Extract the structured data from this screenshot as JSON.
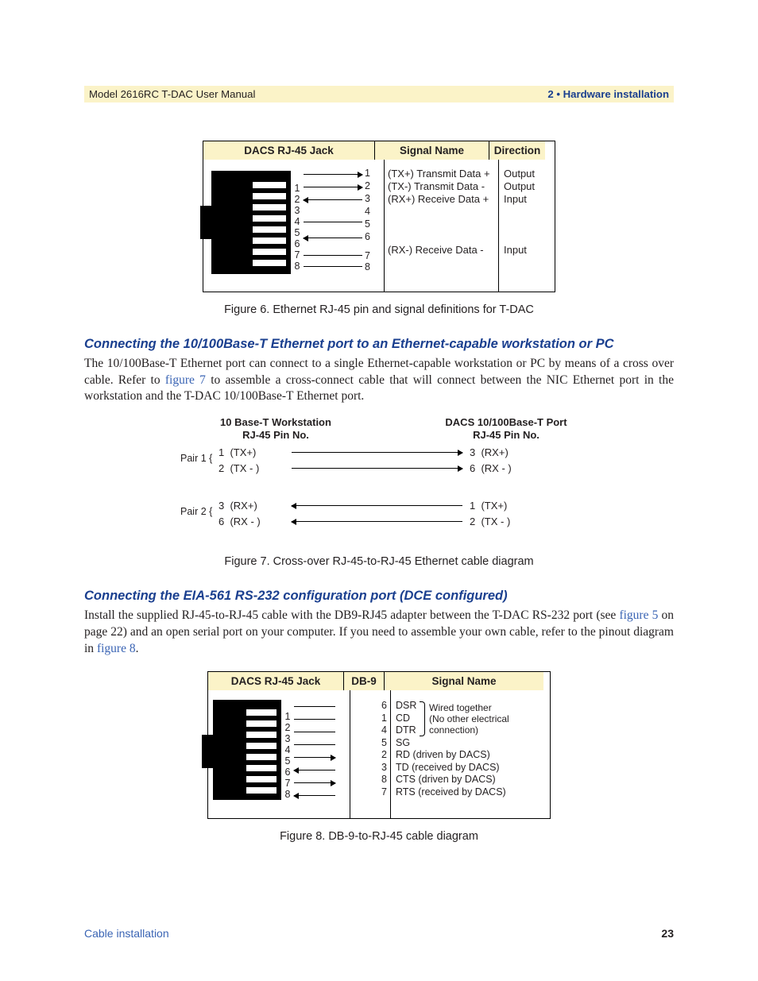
{
  "header": {
    "left": "Model 2616RC T-DAC User Manual",
    "right": "2 • Hardware installation"
  },
  "figure6": {
    "caption": "Figure 6. Ethernet RJ-45 pin and signal definitions for T-DAC",
    "cols": [
      "DACS RJ-45 Jack",
      "Signal Name",
      "Direction"
    ],
    "pins_drawn": [
      1,
      2,
      3,
      4,
      5,
      6,
      7,
      8
    ],
    "leads": [
      {
        "jack_pin": 1,
        "far_pin": 1,
        "dir": "out",
        "signal": "(TX+) Transmit Data +",
        "direction": "Output"
      },
      {
        "jack_pin": 2,
        "far_pin": 2,
        "dir": "out",
        "signal": "(TX-) Transmit Data -",
        "direction": "Output"
      },
      {
        "jack_pin": 3,
        "far_pin": 3,
        "dir": "in",
        "signal": "(RX+) Receive Data +",
        "direction": "Input"
      },
      {
        "jack_pin": 6,
        "far_pin": 6,
        "dir": "in",
        "signal": "(RX-) Receive Data -",
        "direction": "Input"
      }
    ]
  },
  "section1": {
    "title": "Connecting the 10/100Base-T Ethernet port to an Ethernet-capable workstation or PC",
    "para_a": "The 10/100Base-T Ethernet port can connect to a single Ethernet-capable workstation or PC by means of a cross over cable. Refer to ",
    "link7": "figure 7",
    "para_b": " to assemble a cross-connect cable that will connect between the NIC Ethernet port in the workstation and the T-DAC 10/100Base-T Ethernet port."
  },
  "figure7": {
    "caption": "Figure 7. Cross-over RJ-45-to-RJ-45 Ethernet cable diagram",
    "left_head_a": "10 Base-T Workstation",
    "left_head_b": "RJ-45 Pin No.",
    "right_head_a": "DACS 10/100Base-T Port",
    "right_head_b": "RJ-45 Pin No.",
    "pair1_label": "Pair 1 {",
    "pair2_label": "Pair 2 {",
    "rows": [
      {
        "l_pin": "1",
        "l_sig": "(TX+)",
        "r_pin": "3",
        "r_sig": "(RX+)",
        "arrow": "r"
      },
      {
        "l_pin": "2",
        "l_sig": "(TX - )",
        "r_pin": "6",
        "r_sig": "(RX - )",
        "arrow": "r"
      },
      {
        "l_pin": "3",
        "l_sig": "(RX+)",
        "r_pin": "1",
        "r_sig": "(TX+)",
        "arrow": "l"
      },
      {
        "l_pin": "6",
        "l_sig": "(RX - )",
        "r_pin": "2",
        "r_sig": "(TX - )",
        "arrow": "l"
      }
    ]
  },
  "section2": {
    "title": "Connecting the EIA-561 RS-232 configuration port (DCE configured)",
    "para_a": "Install the supplied RJ-45-to-RJ-45 cable with the DB9-RJ45 adapter between the T-DAC RS-232 port (see ",
    "link5": "figure 5",
    "para_b": " on page 22) and an open serial port on your computer. If you need to assemble your own cable, refer to the pinout diagram in ",
    "link8": "figure 8",
    "para_c": "."
  },
  "figure8": {
    "caption": "Figure 8. DB-9-to-RJ-45 cable diagram",
    "cols": [
      "DACS RJ-45 Jack",
      "DB-9",
      "Signal Name"
    ],
    "bracket_text_a": "Wired together",
    "bracket_text_b": "(No other electrical",
    "bracket_text_c": "connection)",
    "rows": [
      {
        "jack": "1",
        "db9": "6",
        "sig": "DSR",
        "arrow": ""
      },
      {
        "jack": "2",
        "db9": "1",
        "sig": "CD",
        "arrow": ""
      },
      {
        "jack": "3",
        "db9": "4",
        "sig": "DTR",
        "arrow": ""
      },
      {
        "jack": "4",
        "db9": "5",
        "sig": "SG",
        "arrow": ""
      },
      {
        "jack": "5",
        "db9": "2",
        "sig": "RD (driven by DACS)",
        "arrow": "out"
      },
      {
        "jack": "6",
        "db9": "3",
        "sig": "TD (received by DACS)",
        "arrow": "in"
      },
      {
        "jack": "7",
        "db9": "8",
        "sig": "CTS (driven by DACS)",
        "arrow": "out"
      },
      {
        "jack": "8",
        "db9": "7",
        "sig": "RTS (received by DACS)",
        "arrow": "in"
      }
    ]
  },
  "footer": {
    "left": "Cable installation",
    "right": "23"
  }
}
